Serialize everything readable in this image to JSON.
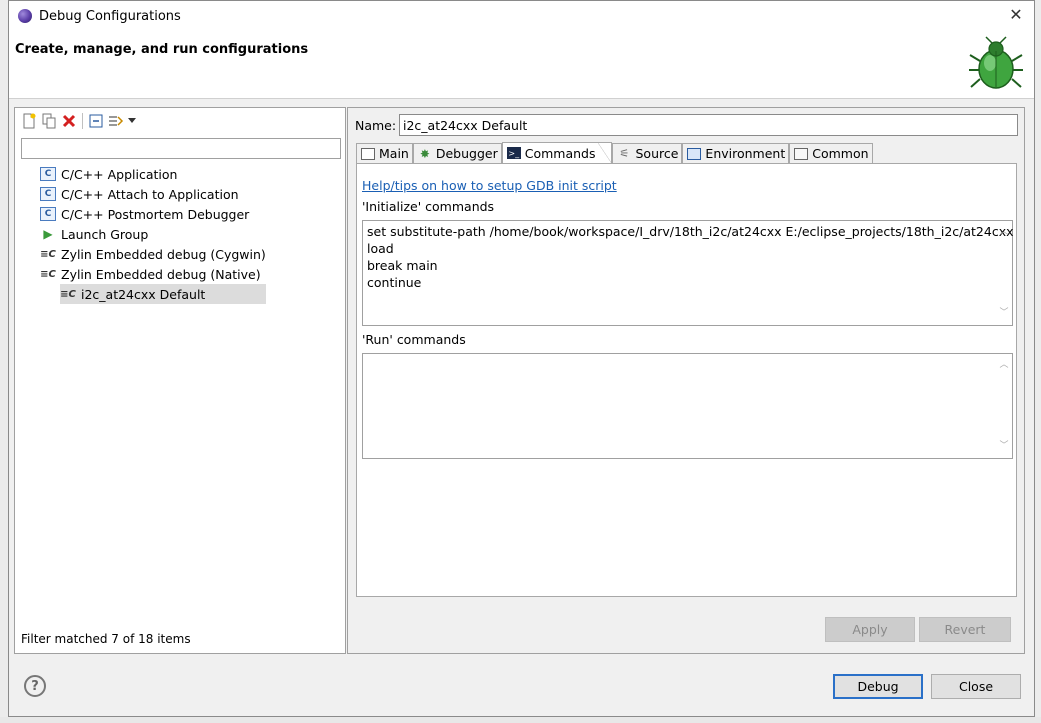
{
  "window": {
    "title": "Debug Configurations",
    "header_title": "Create, manage, and run configurations",
    "close_glyph": "✕"
  },
  "left": {
    "filter_placeholder": "",
    "items": [
      {
        "label": "C/C++ Application",
        "icon": "c-app-icon"
      },
      {
        "label": "C/C++ Attach to Application",
        "icon": "c-app-icon"
      },
      {
        "label": "C/C++ Postmortem Debugger",
        "icon": "c-app-icon"
      },
      {
        "label": "Launch Group",
        "icon": "launch-group-icon"
      },
      {
        "label": "Zylin Embedded debug (Cygwin)",
        "icon": "zylin-icon"
      },
      {
        "label": "Zylin Embedded debug (Native)",
        "icon": "zylin-icon"
      },
      {
        "label": "i2c_at24cxx Default",
        "icon": "zylin-icon",
        "selected": true
      }
    ],
    "status": "Filter matched 7 of 18 items"
  },
  "right": {
    "name_label": "Name:",
    "name_value": "i2c_at24cxx Default",
    "tabs": [
      {
        "label": "Main"
      },
      {
        "label": "Debugger"
      },
      {
        "label": "Commands",
        "active": true
      },
      {
        "label": "Source"
      },
      {
        "label": "Environment"
      },
      {
        "label": "Common"
      }
    ],
    "help_link": "Help/tips on how to setup GDB init script",
    "init_label": "'Initialize' commands",
    "init_lines": [
      "set substitute-path /home/book/workspace/I_drv/18th_i2c/at24cxx E:/eclipse_projects/18th_i2c/at24cxx",
      "load",
      "break main",
      "continue"
    ],
    "run_label": "'Run' commands",
    "apply_label": "Apply",
    "revert_label": "Revert"
  },
  "footer": {
    "help_glyph": "?",
    "debug_label": "Debug",
    "close_label": "Close"
  },
  "colors": {
    "link": "#1a5fb4",
    "default_button_border": "#2a70c8"
  }
}
